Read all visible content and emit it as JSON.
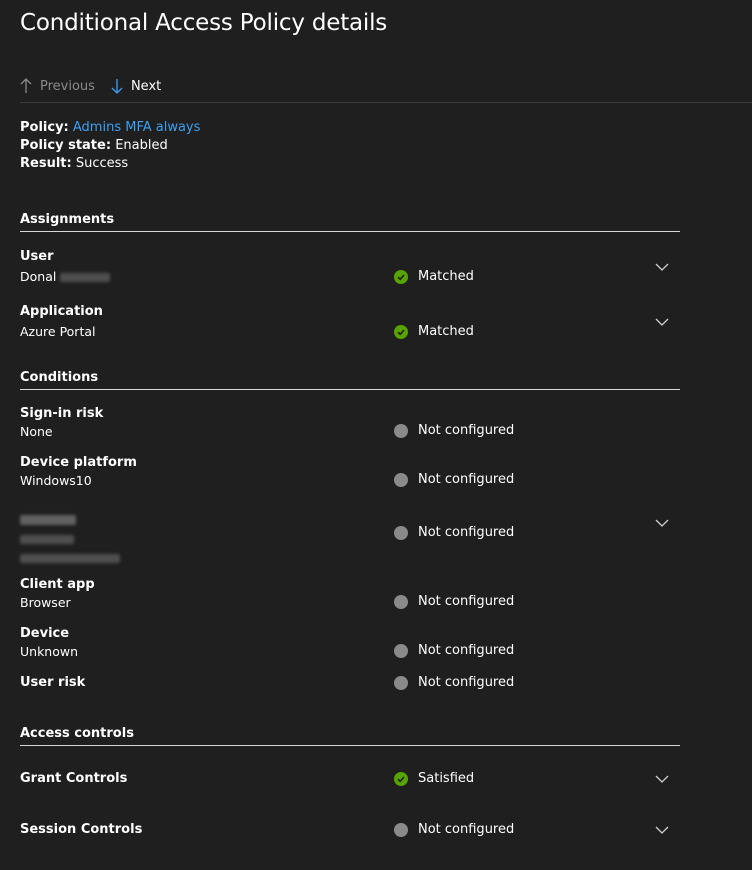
{
  "page": {
    "title": "Conditional Access Policy details"
  },
  "nav": {
    "previous": "Previous",
    "next": "Next"
  },
  "policy": {
    "policy_label": "Policy:",
    "policy_name": "Admins MFA always",
    "state_label": "Policy state:",
    "state_value": "Enabled",
    "result_label": "Result:",
    "result_value": "Success"
  },
  "sections": {
    "assignments": "Assignments",
    "conditions": "Conditions",
    "access_controls": "Access controls"
  },
  "assignments": {
    "user": {
      "label": "User",
      "value": "Donal",
      "status": "Matched"
    },
    "application": {
      "label": "Application",
      "value": "Azure Portal",
      "status": "Matched"
    }
  },
  "conditions": {
    "signin_risk": {
      "label": "Sign-in risk",
      "value": "None",
      "status": "Not configured"
    },
    "device_platform": {
      "label": "Device platform",
      "value": "Windows10",
      "status": "Not configured"
    },
    "location": {
      "status": "Not configured"
    },
    "client_app": {
      "label": "Client app",
      "value": "Browser",
      "status": "Not configured"
    },
    "device": {
      "label": "Device",
      "value": "Unknown",
      "status": "Not configured"
    },
    "user_risk": {
      "label": "User risk",
      "status": "Not configured"
    }
  },
  "access_controls": {
    "grant": {
      "label": "Grant Controls",
      "status": "Satisfied"
    },
    "session": {
      "label": "Session Controls",
      "status": "Not configured"
    }
  },
  "colors": {
    "background": "#1f1f1f",
    "link": "#3aa0f3",
    "success": "#57a300",
    "neutral": "#8a8a8a",
    "next_arrow": "#3aa0f3"
  }
}
